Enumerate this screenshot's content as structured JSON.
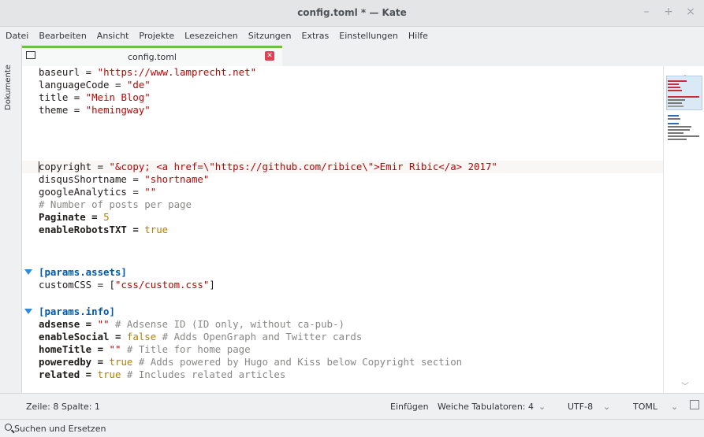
{
  "window": {
    "title": "config.toml * — Kate",
    "buttons": [
      "–",
      "+",
      "×"
    ]
  },
  "menu": [
    "Datei",
    "Bearbeiten",
    "Ansicht",
    "Projekte",
    "Lesezeichen",
    "Sitzungen",
    "Extras",
    "Einstellungen",
    "Hilfe"
  ],
  "sidebar": {
    "tab_label": "Dokumente"
  },
  "tab": {
    "name": "config.toml"
  },
  "code": {
    "l1_k": "baseurl = ",
    "l1_v": "\"https://www.lamprecht.net\"",
    "l2_k": "languageCode = ",
    "l2_v": "\"de\"",
    "l3_k": "title = ",
    "l3_v": "\"Mein Blog\"",
    "l4_k": "theme = ",
    "l4_v": "\"hemingway\"",
    "l8_k": "copyright = ",
    "l8_v": "\"&copy; <a href=\\\"https://github.com/ribice\\\">Emir Ribic</a> 2017\"",
    "l9_k": "disqusShortname = ",
    "l9_v": "\"shortname\"",
    "l10_k": "googleAnalytics = ",
    "l10_v": "\"\"",
    "l11_c": "# Number of posts per page",
    "l12_k": "Paginate = ",
    "l12_v": "5",
    "l13_k": "enableRobotsTXT = ",
    "l13_v": "true",
    "l16_s": "[params.assets]",
    "l17_k": "customCSS = [",
    "l17_v": "\"css/custom.css\"",
    "l17_e": "]",
    "l19_s": "[params.info]",
    "l20_k": "adsense = ",
    "l20_v": "\"\"",
    "l20_c": " # Adsense ID (ID only, without ca-pub-)",
    "l21_k": "enableSocial = ",
    "l21_v": "false",
    "l21_c": " # Adds OpenGraph and Twitter cards",
    "l22_k": "homeTitle = ",
    "l22_v": "\"\"",
    "l22_c": " # Title for home page",
    "l23_k": "poweredby = ",
    "l23_v": "true",
    "l23_c": " # Adds powered by Hugo and Kiss below Copyright section",
    "l24_k": "related = ",
    "l24_v": "true",
    "l24_c": " # Includes related articles"
  },
  "status": {
    "position": "Zeile: 8 Spalte: 1",
    "mode": "Einfügen",
    "indent": "Weiche Tabulatoren: 4",
    "encoding": "UTF-8",
    "syntax": "TOML"
  },
  "findbar": {
    "label": "Suchen und Ersetzen"
  }
}
